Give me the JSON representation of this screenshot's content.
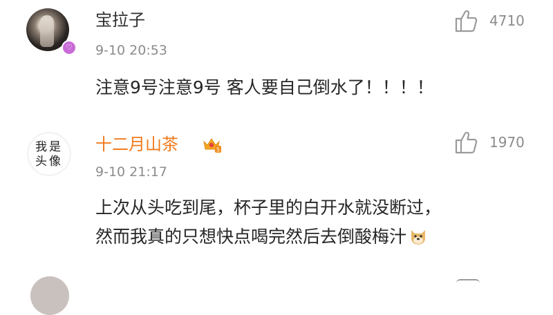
{
  "comments": [
    {
      "username": "宝拉子",
      "timestamp": "9-10 20:53",
      "content_lines": [
        "注意9号注意9号 客人要自己倒水了！！！！"
      ],
      "likes": "4710",
      "avatar": "user-photo",
      "badge": "vip-badge-purple"
    },
    {
      "username": "十二月山茶",
      "timestamp": "9-10 21:17",
      "content_lines": [
        "上次从头吃到尾，杯子里的白开水就没断过，",
        "然而我真的只想快点喝完然后去倒酸梅汁"
      ],
      "likes": "1970",
      "avatar_text": "我是\n头像",
      "name_color": "#f07a1c",
      "member_icon": "crown-icon",
      "emoji": "doge-emoji"
    }
  ],
  "colors": {
    "text": "#262626",
    "meta": "#8b8b8b",
    "member_name": "#f07a1c"
  }
}
